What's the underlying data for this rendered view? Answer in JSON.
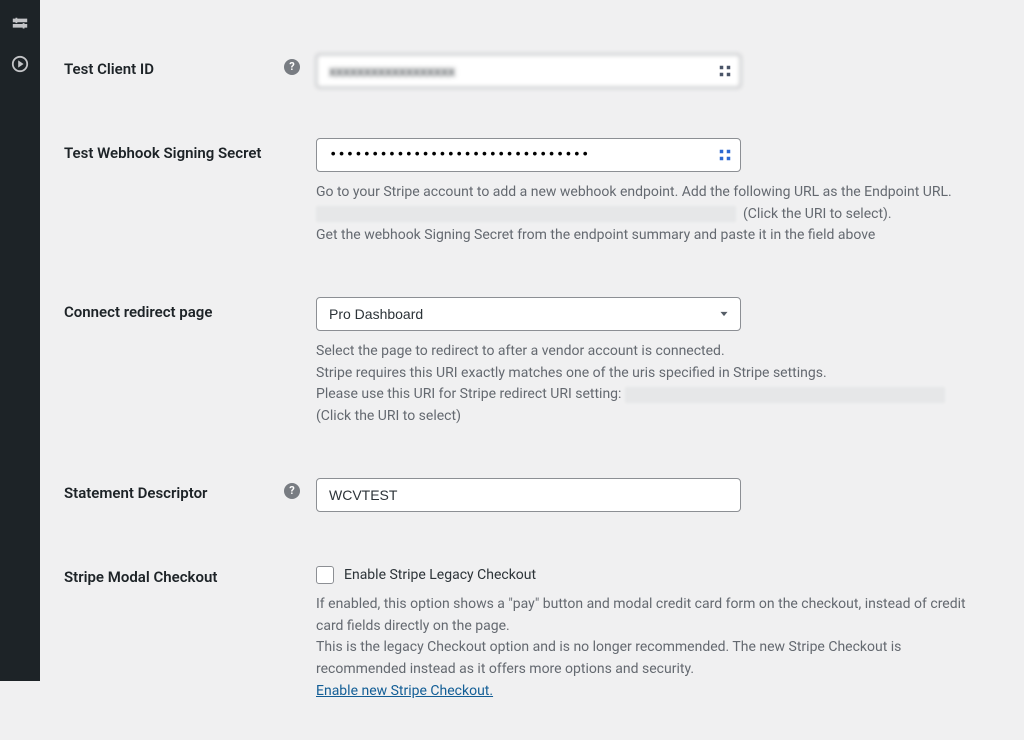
{
  "adminbar": {
    "icon1": "tools-icon",
    "icon2": "play-icon"
  },
  "fields": {
    "client_id": {
      "label": "Test Client ID",
      "value_blurred": "xxxxxxxxxxxxxxxxxx"
    },
    "webhook_secret": {
      "label": "Test Webhook Signing Secret",
      "value_dots": "•••••••••••••••••••••••••••••••",
      "desc1a": "Go to your Stripe account to add a new webhook endpoint. Add the following URL as the Endpoint URL.",
      "desc1b_tail": "(Click the URI to select).",
      "desc2": "Get the webhook Signing Secret from the endpoint summary and paste it in the field above"
    },
    "connect_redirect": {
      "label": "Connect redirect page",
      "selected": "Pro Dashboard",
      "desc1": "Select the page to redirect to after a vendor account is connected.",
      "desc2": "Stripe requires this URI exactly matches one of the uris specified in Stripe settings.",
      "desc3_lead": "Please use this URI for Stripe redirect URI setting: ",
      "desc4": "(Click the URI to select)"
    },
    "statement_descriptor": {
      "label": "Statement Descriptor",
      "value": "WCVTEST"
    },
    "modal_checkout": {
      "label": "Stripe Modal Checkout",
      "checkbox_label": "Enable Stripe Legacy Checkout",
      "desc1": "If enabled, this option shows a \"pay\" button and modal credit card form on the checkout, instead of credit card fields directly on the page.",
      "desc2": "This is the legacy Checkout option and is no longer recommended. The new Stripe Checkout is recommended instead as it offers more options and security.",
      "link_text": "Enable new Stripe Checkout."
    }
  }
}
